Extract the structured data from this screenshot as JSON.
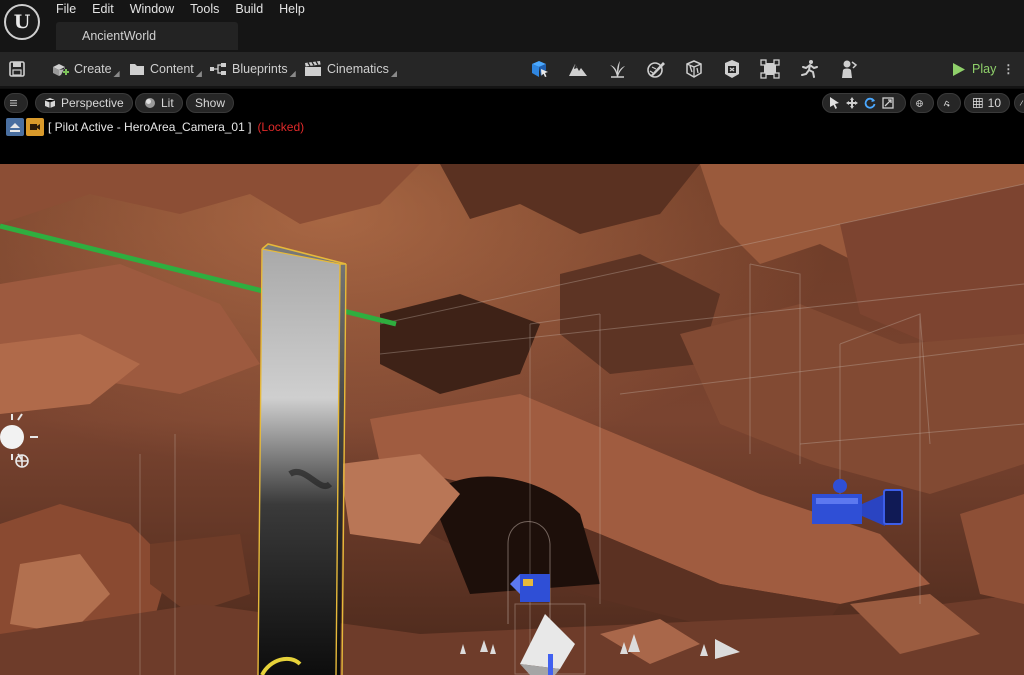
{
  "app": {
    "logo_letter": "U"
  },
  "menu": {
    "items": [
      "File",
      "Edit",
      "Window",
      "Tools",
      "Build",
      "Help"
    ]
  },
  "document_tab": {
    "title": "AncientWorld"
  },
  "toolbar": {
    "save_icon": "save-icon",
    "create_label": "Create",
    "content_label": "Content",
    "blueprints_label": "Blueprints",
    "cinematics_label": "Cinematics",
    "mode_icons": [
      "selection-mode-icon",
      "landscape-icon",
      "foliage-icon",
      "mesh-paint-icon",
      "fracture-icon",
      "brush-edit-icon",
      "modeling-icon",
      "animation-icon",
      "character-icon"
    ],
    "play_label": "Play"
  },
  "viewport": {
    "perspective_label": "Perspective",
    "lit_label": "Lit",
    "show_label": "Show",
    "grid_snap_value": "10",
    "pilot_text": "[ Pilot Active - HeroArea_Camera_01 ]",
    "locked_text": "(Locked)",
    "colors": {
      "locked": "#e02a2a",
      "play": "#8fd06a",
      "selection": "#e6b93a",
      "camera_gizmo": "#2f4fd6"
    }
  }
}
